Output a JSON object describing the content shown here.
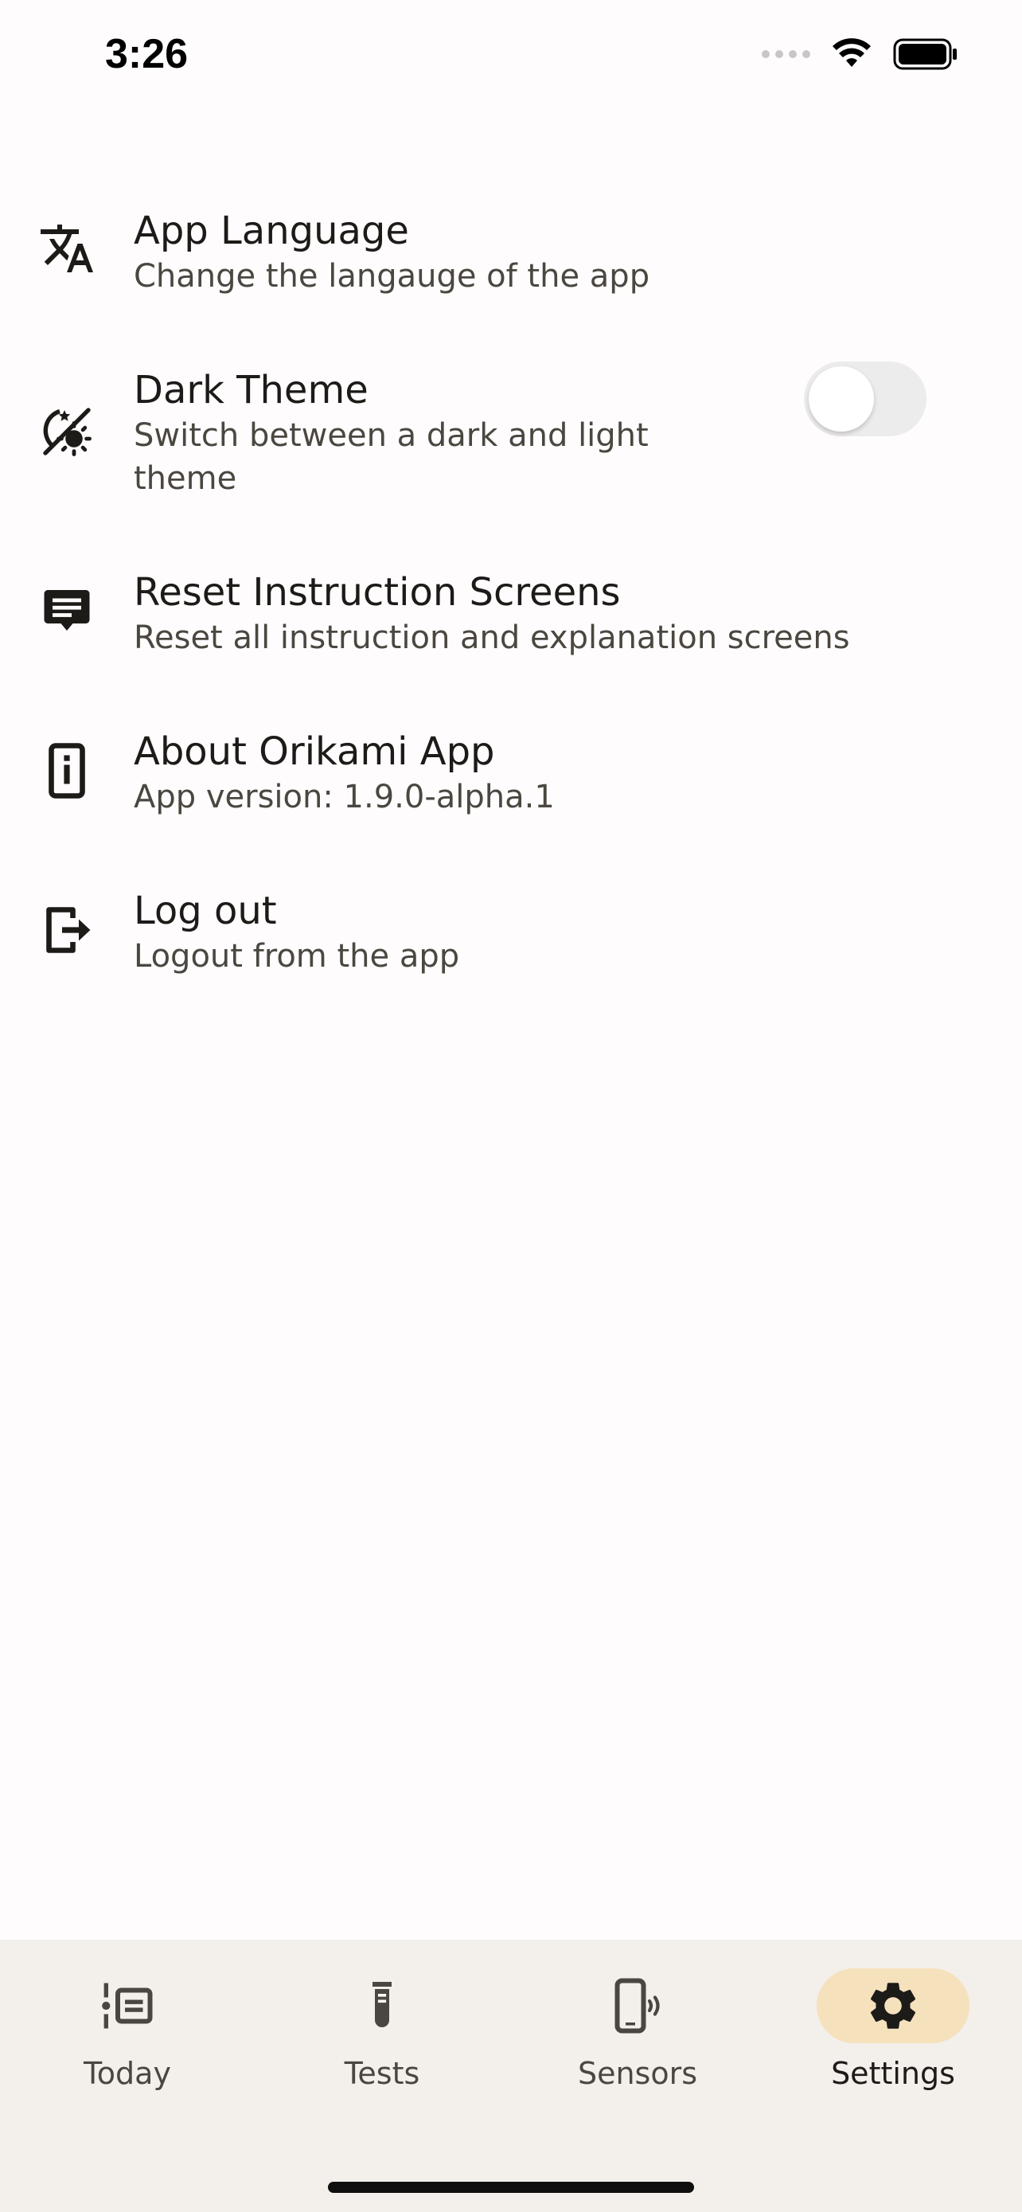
{
  "status_bar": {
    "time": "3:26"
  },
  "settings": [
    {
      "key": "language",
      "icon": "translate-icon",
      "title": "App Language",
      "subtitle": "Change the langauge of the app"
    },
    {
      "key": "dark_theme",
      "icon": "theme-icon",
      "title": "Dark Theme",
      "subtitle": "Switch between a dark and light theme",
      "toggle_on": false
    },
    {
      "key": "reset",
      "icon": "instruction-icon",
      "title": "Reset Instruction Screens",
      "subtitle": "Reset all instruction and explanation screens"
    },
    {
      "key": "about",
      "icon": "info-icon",
      "title": "About Orikami App",
      "subtitle": "App version: 1.9.0-alpha.1"
    },
    {
      "key": "logout",
      "icon": "logout-icon",
      "title": "Log out",
      "subtitle": "Logout from the app"
    }
  ],
  "nav": {
    "items": [
      {
        "label": "Today",
        "icon": "today-icon"
      },
      {
        "label": "Tests",
        "icon": "test-tube-icon"
      },
      {
        "label": "Sensors",
        "icon": "phone-sensor-icon"
      },
      {
        "label": "Settings",
        "icon": "gear-icon",
        "active": true
      }
    ]
  },
  "colors": {
    "background": "#fffcfd",
    "nav_background": "#f3efea",
    "active_pill": "#f6e1bd",
    "text_primary": "#1d1b18",
    "text_secondary": "#4b4740"
  }
}
